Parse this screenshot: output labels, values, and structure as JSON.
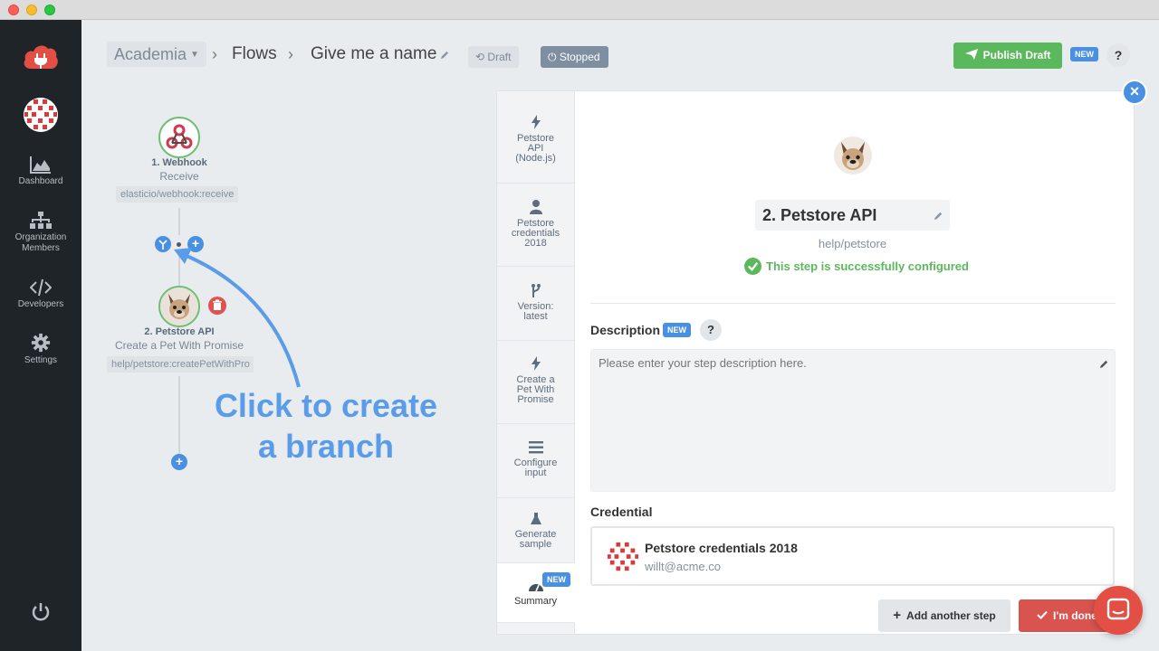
{
  "header": {
    "org": "Academia",
    "flows": "Flows",
    "flow_name": "Give me a name",
    "draft_label": "Draft",
    "stopped_label": "Stopped",
    "publish_label": "Publish Draft",
    "new_badge": "NEW",
    "help": "?"
  },
  "sidebar": {
    "items": [
      {
        "label": "Dashboard",
        "icon": "chart-area-icon"
      },
      {
        "label": "Organization Members",
        "icon": "org-chart-icon"
      },
      {
        "label": "Developers",
        "icon": "code-icon"
      },
      {
        "label": "Settings",
        "icon": "gear-icon"
      }
    ]
  },
  "flow": {
    "step1": {
      "title": "1. Webhook",
      "subtitle": "Receive",
      "component": "elasticio/webhook:receive"
    },
    "step2": {
      "title": "2. Petstore API",
      "subtitle": "Create a Pet With Promise",
      "component": "help/petstore:createPetWithPro"
    },
    "annotation_line1": "Click to create",
    "annotation_line2": "a branch"
  },
  "panel": {
    "tabs": [
      {
        "line1": "Petstore",
        "line2": "API",
        "line3": "(Node.js)"
      },
      {
        "line1": "Petstore",
        "line2": "credentials",
        "line3": "2018"
      },
      {
        "line1": "Version:",
        "line2": "latest"
      },
      {
        "line1": "Create a",
        "line2": "Pet With",
        "line3": "Promise"
      },
      {
        "line1": "Configure",
        "line2": "input"
      },
      {
        "line1": "Generate",
        "line2": "sample"
      },
      {
        "line1": "Summary",
        "badge": "NEW"
      }
    ],
    "step_name": "2. Petstore API",
    "step_path": "help/petstore",
    "status": "This step is successfully configured",
    "description_label": "Description",
    "description_new": "NEW",
    "description_placeholder": "Please enter your step description here.",
    "credential_label": "Credential",
    "credential_name": "Petstore credentials 2018",
    "credential_email": "willt@acme.co",
    "add_step_label": "Add another step",
    "done_label": "I'm done"
  },
  "colors": {
    "accent": "#4a90e2",
    "success": "#5cb85c",
    "danger": "#d9534f",
    "sidebar": "#1f2429"
  }
}
